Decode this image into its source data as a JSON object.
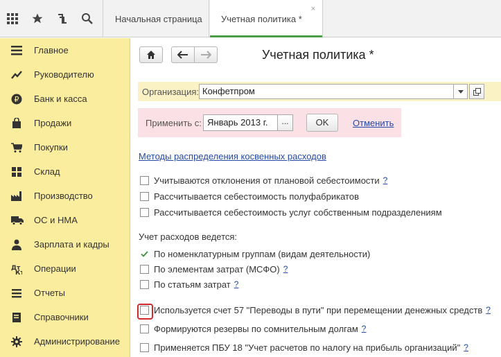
{
  "topbar": {
    "icons": [
      "grid-icon",
      "star-icon",
      "history-icon",
      "search-icon"
    ],
    "tabs": [
      {
        "label": "Начальная страница"
      },
      {
        "label": "Учетная политика *"
      }
    ],
    "close_glyph": "×"
  },
  "sidebar": {
    "items": [
      {
        "label": "Главное",
        "icon": "menu-icon"
      },
      {
        "label": "Руководителю",
        "icon": "trend-icon"
      },
      {
        "label": "Банк и касса",
        "icon": "ruble-icon"
      },
      {
        "label": "Продажи",
        "icon": "shopping-bag-icon"
      },
      {
        "label": "Покупки",
        "icon": "cart-icon"
      },
      {
        "label": "Склад",
        "icon": "warehouse-icon"
      },
      {
        "label": "Производство",
        "icon": "factory-icon"
      },
      {
        "label": "ОС и НМА",
        "icon": "truck-icon"
      },
      {
        "label": "Зарплата и кадры",
        "icon": "person-icon"
      },
      {
        "label": "Операции",
        "icon": "operations-icon"
      },
      {
        "label": "Отчеты",
        "icon": "reports-icon"
      },
      {
        "label": "Справочники",
        "icon": "book-icon"
      },
      {
        "label": "Администрирование",
        "icon": "gear-icon"
      }
    ]
  },
  "main": {
    "title": "Учетная политика *",
    "organization": {
      "label": "Организация:",
      "value": "Конфетпром"
    },
    "apply": {
      "label": "Применить с:",
      "value": "Январь 2013 г.",
      "dots": "...",
      "ok": "OK",
      "cancel": "Отменить"
    },
    "methods_link": "Методы распределения косвенных расходов",
    "group1": [
      {
        "label": "Учитываются отклонения от плановой себестоимости",
        "checked": false,
        "help": "?"
      },
      {
        "label": "Рассчитывается себестоимость полуфабрикатов",
        "checked": false,
        "help": ""
      },
      {
        "label": "Рассчитывается себестоимость услуг собственным подразделениям",
        "checked": false,
        "help": ""
      }
    ],
    "section_label": "Учет расходов ведется:",
    "group2": [
      {
        "label": "По номенклатурным группам (видам деятельности)",
        "checked": true,
        "help": ""
      },
      {
        "label": "По элементам затрат (МСФО)",
        "checked": false,
        "help": "?"
      },
      {
        "label": "По статьям затрат",
        "checked": false,
        "help": "?"
      }
    ],
    "group3": [
      {
        "label": "Используется счет 57 \"Переводы в пути\" при перемещении денежных средств",
        "checked": false,
        "help": "?",
        "highlighted": true
      },
      {
        "label": "Формируются резервы по сомнительным долгам",
        "checked": false,
        "help": "?"
      },
      {
        "label": "Применяется ПБУ 18 \"Учет расчетов по налогу на прибыль организаций\"",
        "checked": false,
        "help": "?"
      }
    ]
  },
  "colors": {
    "sidebar_bg": "#fbed9e",
    "accent_green": "#4b9d47",
    "link_blue": "#2449a8",
    "org_bg": "#faf1c4",
    "apply_bg": "#fbe1e5",
    "highlight_red": "#d1282b"
  }
}
